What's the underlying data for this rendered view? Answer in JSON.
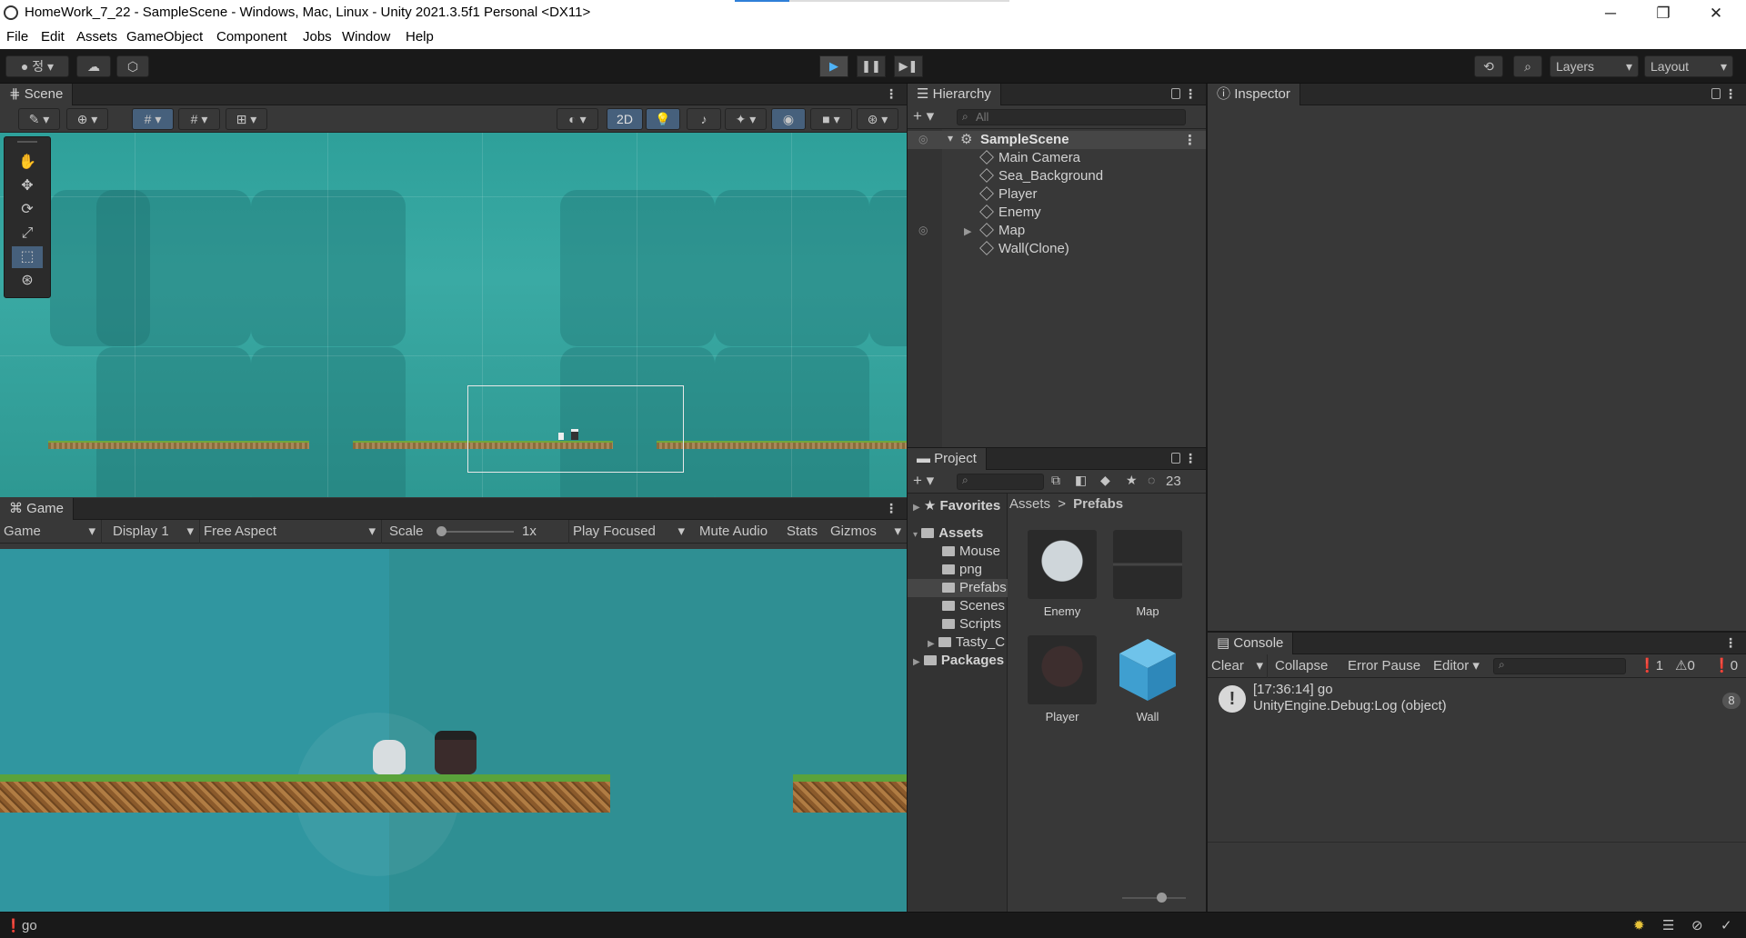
{
  "window": {
    "title": "HomeWork_7_22 - SampleScene - Windows, Mac, Linux - Unity 2021.3.5f1 Personal <DX11>",
    "minimize": "─",
    "maximize": "❐",
    "close": "✕"
  },
  "menu": [
    "File",
    "Edit",
    "Assets",
    "GameObject",
    "Component",
    "Jobs",
    "Window",
    "Help"
  ],
  "toolbar": {
    "account_label": "정",
    "layers": "Layers",
    "layout": "Layout",
    "play_icon": "▶",
    "pause_icon": "❚❚",
    "step_icon": "▶❚"
  },
  "scene": {
    "tab": "Scene",
    "btn_2d": "2D"
  },
  "game": {
    "tab": "Game",
    "mode": "Game",
    "display": "Display 1",
    "aspect": "Free Aspect",
    "scale_label": "Scale",
    "scale_value": "1x",
    "play_focused": "Play Focused",
    "mute": "Mute Audio",
    "stats": "Stats",
    "gizmos": "Gizmos"
  },
  "hierarchy": {
    "tab": "Hierarchy",
    "search_placeholder": "All",
    "scene_name": "SampleScene",
    "items": [
      "Main Camera",
      "Sea_Background",
      "Player",
      "Enemy",
      "Map",
      "Wall(Clone)"
    ]
  },
  "inspector": {
    "tab": "Inspector"
  },
  "project": {
    "tab": "Project",
    "hidden_count": "23",
    "favorites": "Favorites",
    "assets_root": "Assets",
    "folders": [
      "Mouse",
      "png",
      "Prefabs",
      "Scenes",
      "Scripts",
      "Tasty_C"
    ],
    "packages": "Packages",
    "breadcrumb_root": "Assets",
    "breadcrumb_sep": ">",
    "breadcrumb_current": "Prefabs",
    "assets": [
      "Enemy",
      "Map",
      "Player",
      "Wall"
    ]
  },
  "console": {
    "tab": "Console",
    "clear": "Clear",
    "collapse": "Collapse",
    "error_pause": "Error Pause",
    "editor": "Editor",
    "count_info": "1",
    "count_warn": "0",
    "count_err": "0",
    "log_time_msg": "[17:36:14] go",
    "log_detail": "UnityEngine.Debug:Log (object)",
    "log_count": "8"
  },
  "status": {
    "message": "go"
  }
}
